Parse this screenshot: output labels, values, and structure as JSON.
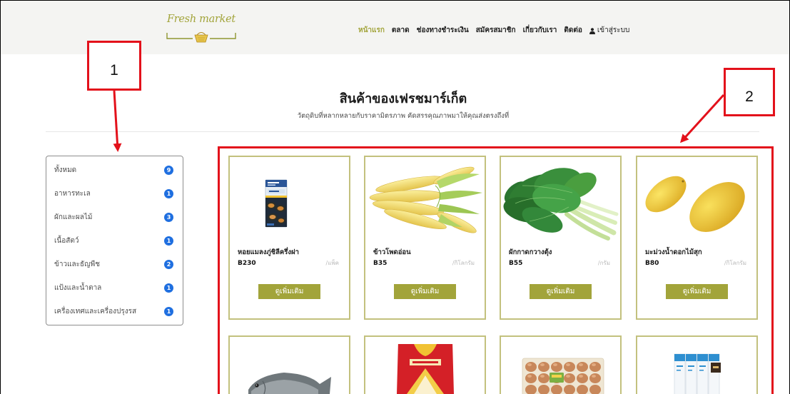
{
  "brand": {
    "name": "Fresh market",
    "logo_icon": "basket-icon"
  },
  "nav": {
    "items": [
      {
        "label": "หน้าแรก",
        "active": true
      },
      {
        "label": "ตลาด"
      },
      {
        "label": "ช่องทางชำระเงิน"
      },
      {
        "label": "สมัครสมาชิก"
      },
      {
        "label": "เกี่ยวกับเรา"
      },
      {
        "label": "ติดต่อ"
      }
    ],
    "login": {
      "label": "เข้าสู่ระบบ",
      "icon": "user-icon"
    }
  },
  "section": {
    "title": "สินค้าของเฟรชมาร์เก็ต",
    "subtitle": "วัตถุดิบที่หลากหลายกับราคามิตรภาพ คัดสรรคุณภาพมาให้คุณส่งตรงถึงที่"
  },
  "categories": [
    {
      "label": "ทั้งหมด",
      "count": "9"
    },
    {
      "label": "อาหารทะเล",
      "count": "1"
    },
    {
      "label": "ผักและผลไม้",
      "count": "3"
    },
    {
      "label": "เนื้อสัตว์",
      "count": "1"
    },
    {
      "label": "ข้าวและธัญพืช",
      "count": "2"
    },
    {
      "label": "แป้งและน้ำตาล",
      "count": "1"
    },
    {
      "label": "เครื่องเทศและเครื่องปรุงรส",
      "count": "1"
    }
  ],
  "products": [
    {
      "name": "หอยแมลงภู่ชิลีครึ่งฝา",
      "price": "B230",
      "unit": "/แพ็ค",
      "button": "ดูเพิ่มเติม",
      "image": "mussel-pack"
    },
    {
      "name": "ข้าวโพดอ่อน",
      "price": "B35",
      "unit": "/กิโลกรัม",
      "button": "ดูเพิ่มเติม",
      "image": "baby-corn"
    },
    {
      "name": "ผักกาดกวางตุ้ง",
      "price": "B55",
      "unit": "/กรัม",
      "button": "ดูเพิ่มเติม",
      "image": "bok-choy"
    },
    {
      "name": "มะม่วงน้ำดอกไม้สุก",
      "price": "B80",
      "unit": "/กิโลกรัม",
      "button": "ดูเพิ่มเติม",
      "image": "mangoes"
    }
  ],
  "products_row2": [
    {
      "image": "fish"
    },
    {
      "image": "rice-bag"
    },
    {
      "image": "egg-tray"
    },
    {
      "image": "packaged-goods"
    }
  ],
  "annotations": {
    "label_1": "1",
    "label_2": "2"
  },
  "colors": {
    "accent": "#a2a43a",
    "card_border": "#c3c17e",
    "category_badge": "#1f6fe0",
    "annotation": "#e3111b",
    "header_bg": "#f4f4f2"
  }
}
